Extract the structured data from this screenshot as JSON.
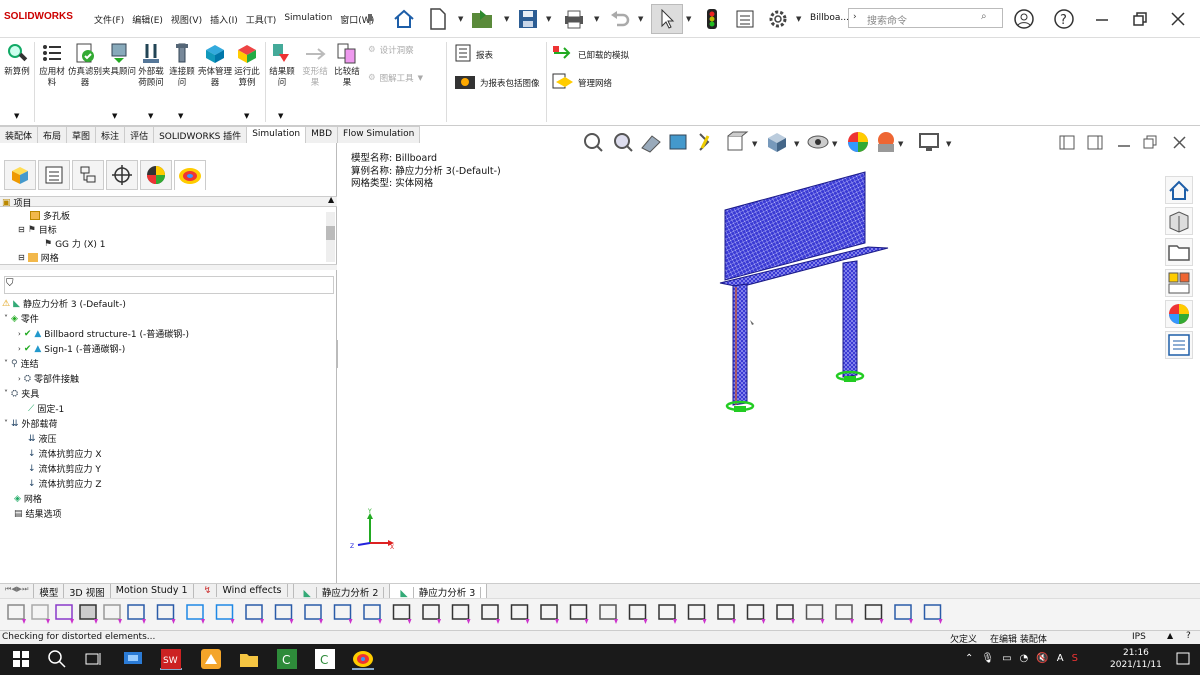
{
  "app": {
    "logo": "SOLIDWORKS",
    "doc_name": "Billboa...",
    "search_placeholder": "搜索命令"
  },
  "menu": [
    "文件(F)",
    "编辑(E)",
    "视图(V)",
    "插入(I)",
    "工具(T)",
    "Simulation",
    "窗口(W)"
  ],
  "ribbon": {
    "buttons": [
      "新算例",
      "应用材料",
      "仿真滤别器",
      "夹具顾问",
      "外部载荷顾问",
      "连接顾问",
      "壳体管理器",
      "运行此算例",
      "结果顾问",
      "变形结果",
      "比较结果"
    ],
    "small": {
      "design_study": "设计洞察",
      "plot_tools": "图解工具",
      "report": "报表",
      "report_image": "为报表包括图像",
      "unloaded_sim": "已卸载的模拟",
      "manage_network": "管理网络"
    }
  },
  "command_tabs": [
    "装配体",
    "布局",
    "草图",
    "标注",
    "评估",
    "SOLIDWORKS 插件",
    "Simulation",
    "MBD",
    "Flow Simulation"
  ],
  "active_command_tab": "Simulation",
  "tree_top": {
    "header": "项目",
    "items": [
      "多孔板",
      "目标",
      "GG 力 (X) 1",
      "网格"
    ]
  },
  "study_tree": {
    "root": "静应力分析 3 (-Default-)",
    "parts_label": "零件",
    "parts": [
      "Billbaord structure-1 (-普通碳钢-)",
      "Sign-1 (-普通碳钢-)"
    ],
    "connections_label": "连结",
    "connections": [
      "零部件接触"
    ],
    "fixtures_label": "夹具",
    "fixtures": [
      "固定-1"
    ],
    "loads_label": "外部载荷",
    "loads": [
      "液压",
      "流体抗剪应力 X",
      "流体抗剪应力 Y",
      "流体抗剪应力 Z"
    ],
    "mesh_label": "网格",
    "results_label": "结果选项"
  },
  "model_info": {
    "model_name": "模型名称: Billboard",
    "study_name": "算例名称: 静应力分析 3(-Default-)",
    "mesh_type": "网格类型: 实体网格"
  },
  "triad": {
    "x": "X",
    "y": "Y",
    "z": "Z"
  },
  "bottom_tabs": [
    "模型",
    "3D 视图",
    "Motion Study 1",
    "Wind effects",
    "静应力分析 2",
    "静应力分析 3"
  ],
  "active_bottom_tab": "静应力分析 3",
  "status": {
    "message": "Checking for distorted elements...",
    "definition": "欠定义",
    "editing": "在编辑 装配体",
    "units": "IPS"
  },
  "taskbar": {
    "time": "21:16",
    "date": "2021/11/11"
  },
  "colors": {
    "mesh_blue": "#2a2acc",
    "fixture_green": "#22cc22",
    "toolbar_bg": "#f4f4f4"
  }
}
